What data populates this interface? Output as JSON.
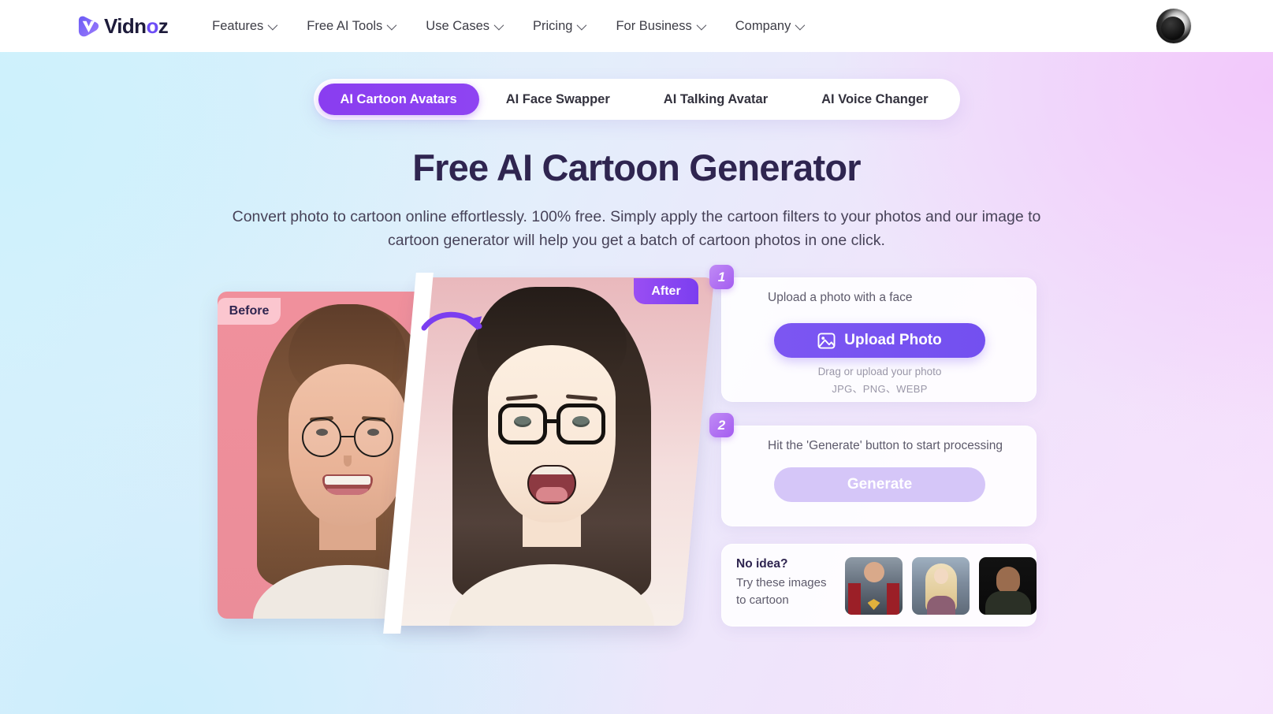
{
  "header": {
    "logo": {
      "text_a": "Vidn",
      "text_o": "o",
      "text_b": "z",
      "icon": "vidnoz-logo-mark"
    },
    "nav": [
      {
        "label": "Features",
        "icon": "chevron-down-icon"
      },
      {
        "label": "Free AI Tools",
        "icon": "chevron-down-icon"
      },
      {
        "label": "Use Cases",
        "icon": "chevron-down-icon"
      },
      {
        "label": "Pricing",
        "icon": "chevron-down-icon"
      },
      {
        "label": "For Business",
        "icon": "chevron-down-icon"
      },
      {
        "label": "Company",
        "icon": "chevron-down-icon"
      }
    ],
    "avatar": {
      "icon": "user-avatar"
    }
  },
  "tabs": [
    {
      "label": "AI Cartoon Avatars",
      "active": true
    },
    {
      "label": "AI Face Swapper",
      "active": false
    },
    {
      "label": "AI Talking Avatar",
      "active": false
    },
    {
      "label": "AI Voice Changer",
      "active": false
    }
  ],
  "hero": {
    "title": "Free AI Cartoon Generator",
    "subtitle": "Convert photo to cartoon online effortlessly. 100% free. Simply apply the cartoon filters to your photos and our image to cartoon generator will help you get a batch of cartoon photos in one click."
  },
  "showcase": {
    "before_label": "Before",
    "after_label": "After",
    "arrow_icon": "curved-arrow-icon",
    "before_image": "woman-with-round-glasses-photo",
    "after_image": "woman-cartoon-avatar-illustration"
  },
  "steps": [
    {
      "number": "1",
      "text": "Upload a photo with a face",
      "button_label": "Upload Photo",
      "button_icon": "image-upload-icon",
      "hint_primary": "Drag or upload your photo",
      "hint_secondary": "JPG、PNG、WEBP"
    },
    {
      "number": "2",
      "text": "Hit the 'Generate' button to start processing",
      "button_label": "Generate"
    }
  ],
  "no_idea": {
    "title": "No idea?",
    "subtitle": "Try these images to cartoon",
    "samples": [
      {
        "name": "superman-sample-image"
      },
      {
        "name": "blonde-woman-sample-image"
      },
      {
        "name": "bald-man-sample-image"
      }
    ]
  },
  "colors": {
    "accent_purple": "#7c56f2",
    "tab_active": "#8b3ff0",
    "title_color": "#2f2550",
    "generate_disabled": "#d5c6f8",
    "before_badge": "#fbc6cf"
  }
}
